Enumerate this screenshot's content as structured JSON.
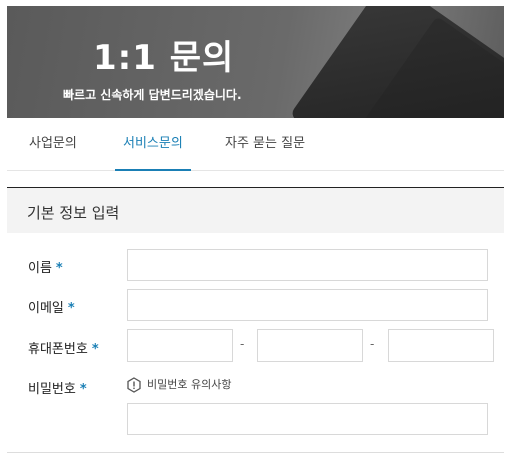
{
  "hero": {
    "title": "1:1 문의",
    "subtitle": "빠르고 신속하게 답변드리겠습니다."
  },
  "tabs": [
    {
      "label": "사업문의",
      "active": false
    },
    {
      "label": "서비스문의",
      "active": true
    },
    {
      "label": "자주 묻는 질문",
      "active": false
    }
  ],
  "form": {
    "section_title": "기본 정보 입력",
    "required_mark": "*",
    "fields": {
      "name": {
        "label": "이름",
        "value": ""
      },
      "email": {
        "label": "이메일",
        "value": ""
      },
      "phone": {
        "label": "휴대폰번호",
        "value": [
          "",
          "",
          ""
        ],
        "separator": "-"
      },
      "password": {
        "label": "비밀번호",
        "value": "",
        "notice": "비밀번호 유의사항"
      }
    }
  },
  "colors": {
    "accent": "#1a7fb5"
  }
}
